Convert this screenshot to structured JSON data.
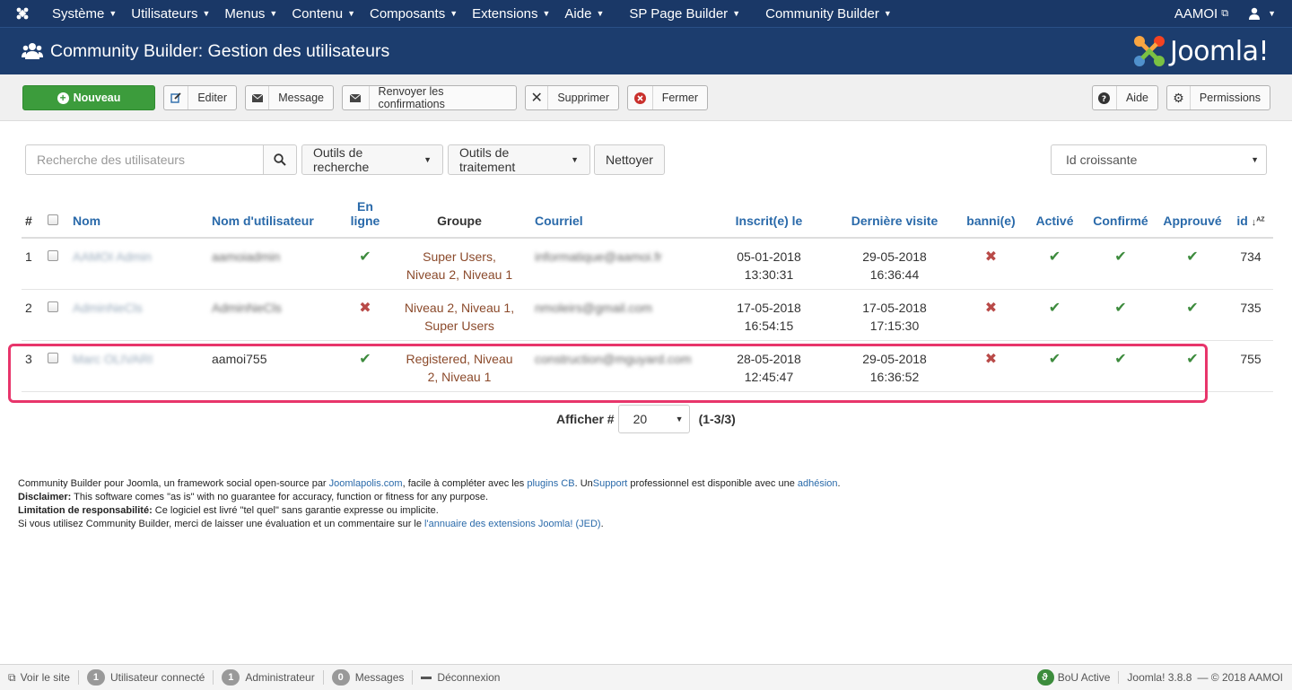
{
  "topnav": {
    "menu": [
      "Système",
      "Utilisateurs",
      "Menus",
      "Contenu",
      "Composants",
      "Extensions",
      "Aide",
      "SP Page Builder",
      "Community Builder"
    ],
    "user": "AAMOI"
  },
  "header": {
    "title": "Community Builder: Gestion des utilisateurs",
    "brand": "Joomla!"
  },
  "toolbar": {
    "new_label": "Nouveau",
    "edit_label": "Editer",
    "message_label": "Message",
    "resend_label": "Renvoyer les confirmations",
    "delete_label": "Supprimer",
    "close_label": "Fermer",
    "help_label": "Aide",
    "permissions_label": "Permissions"
  },
  "filter": {
    "search_placeholder": "Recherche des utilisateurs",
    "search_tools": "Outils de recherche",
    "batch_tools": "Outils de traitement",
    "clear": "Nettoyer",
    "sort": "Id croissante"
  },
  "table": {
    "headers": {
      "num": "#",
      "name": "Nom",
      "username": "Nom d'utilisateur",
      "online_1": "En",
      "online_2": "ligne",
      "group": "Groupe",
      "email": "Courriel",
      "registered": "Inscrit(e) le",
      "last_visit": "Dernière visite",
      "banned": "banni(e)",
      "active": "Activé",
      "confirmed": "Confirmé",
      "approved": "Approuvé",
      "id": "id"
    },
    "rows": [
      {
        "num": "1",
        "name": "AAMOI Admin",
        "username": "aamoiadmin",
        "online": "yes",
        "group_1": "Super Users,",
        "group_2": "Niveau 2, Niveau 1",
        "email": "informatique@aamoi.fr",
        "reg_date": "05-01-2018",
        "reg_time": "13:30:31",
        "last_date": "29-05-2018",
        "last_time": "16:36:44",
        "banned": "yes",
        "active": "yes",
        "confirmed": "yes",
        "approved": "yes",
        "id": "734"
      },
      {
        "num": "2",
        "name": "AdminNeCls",
        "username": "AdminNeCls",
        "online": "no",
        "group_1": "Niveau 2, Niveau 1,",
        "group_2": "Super Users",
        "email": "nmoleirs@gmail.com",
        "reg_date": "17-05-2018",
        "reg_time": "16:54:15",
        "last_date": "17-05-2018",
        "last_time": "17:15:30",
        "banned": "yes",
        "active": "yes",
        "confirmed": "yes",
        "approved": "yes",
        "id": "735"
      },
      {
        "num": "3",
        "name": "Marc OLIVARI",
        "username": "aamoi755",
        "online": "yes",
        "group_1": "Registered, Niveau",
        "group_2": "2, Niveau 1",
        "email": "construction@mguyard.com",
        "reg_date": "28-05-2018",
        "reg_time": "12:45:47",
        "last_date": "29-05-2018",
        "last_time": "16:36:52",
        "banned": "yes",
        "active": "yes",
        "confirmed": "yes",
        "approved": "yes",
        "id": "755"
      }
    ]
  },
  "pager": {
    "label": "Afficher #",
    "limit": "20",
    "range": "(1-3/3)"
  },
  "notes": {
    "l1_a": "Community Builder pour Joomla, un framework social open-source par ",
    "l1_link1": "Joomlapolis.com",
    "l1_b": ", facile à compléter avec les ",
    "l1_link2": "plugins CB",
    "l1_c": ". Un",
    "l1_link3": "Support",
    "l1_d": " professionnel est disponible avec une ",
    "l1_link4": "adhésion",
    "l1_e": ".",
    "l2_bold": "Disclaimer:",
    "l2_text": " This software comes \"as is\" with no guarantee for accuracy, function or fitness for any purpose.",
    "l3_bold": "Limitation de responsabilité:",
    "l3_text": " Ce logiciel est livré \"tel quel\" sans garantie expresse ou implicite.",
    "l4_text": "Si vous utilisez Community Builder, merci de laisser une évaluation et un commentaire sur le ",
    "l4_link": "l'annuaire des extensions Joomla! (JED)",
    "l4_end": "."
  },
  "status": {
    "view_site": "Voir le site",
    "users_count": "1",
    "users_label": "Utilisateur connecté",
    "admins_count": "1",
    "admins_label": "Administrateur",
    "messages_count": "0",
    "messages_label": "Messages",
    "logout": "Déconnexion",
    "bou": "BoU Active",
    "version": "Joomla! 3.8.8",
    "copyright": "— © 2018 AAMOI"
  },
  "colors": {
    "navbar": "#1a3867",
    "header": "#1c3d6e",
    "new_button": "#3c9c3c",
    "link": "#2a6aaa",
    "check": "#3d8b3d",
    "cross": "#b94a48",
    "highlight": "#e8356b"
  }
}
